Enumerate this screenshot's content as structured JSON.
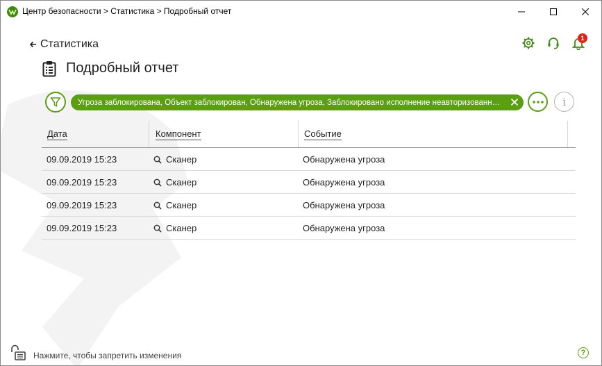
{
  "window": {
    "title": "Центр безопасности > Статистика > Подробный отчет"
  },
  "header": {
    "back_label": "Статистика",
    "page_title": "Подробный отчет",
    "notification_count": "1"
  },
  "filter": {
    "chip_text": "Угроза заблокирована, Объект заблокирован, Обнаружена угроза, Заблокировано исполнение неавторизованного кода"
  },
  "table": {
    "columns": [
      "Дата",
      "Компонент",
      "Событие"
    ],
    "rows": [
      {
        "date": "09.09.2019 15:23",
        "component": "Сканер",
        "event": "Обнаружена угроза"
      },
      {
        "date": "09.09.2019 15:23",
        "component": "Сканер",
        "event": "Обнаружена угроза"
      },
      {
        "date": "09.09.2019 15:23",
        "component": "Сканер",
        "event": "Обнаружена угроза"
      },
      {
        "date": "09.09.2019 15:23",
        "component": "Сканер",
        "event": "Обнаружена угроза"
      }
    ]
  },
  "footer": {
    "lock_text": "Нажмите, чтобы запретить изменения",
    "help_symbol": "?"
  },
  "icons": {
    "info": "i"
  },
  "colors": {
    "accent": "#5a9e12",
    "badge": "#e2231a"
  }
}
